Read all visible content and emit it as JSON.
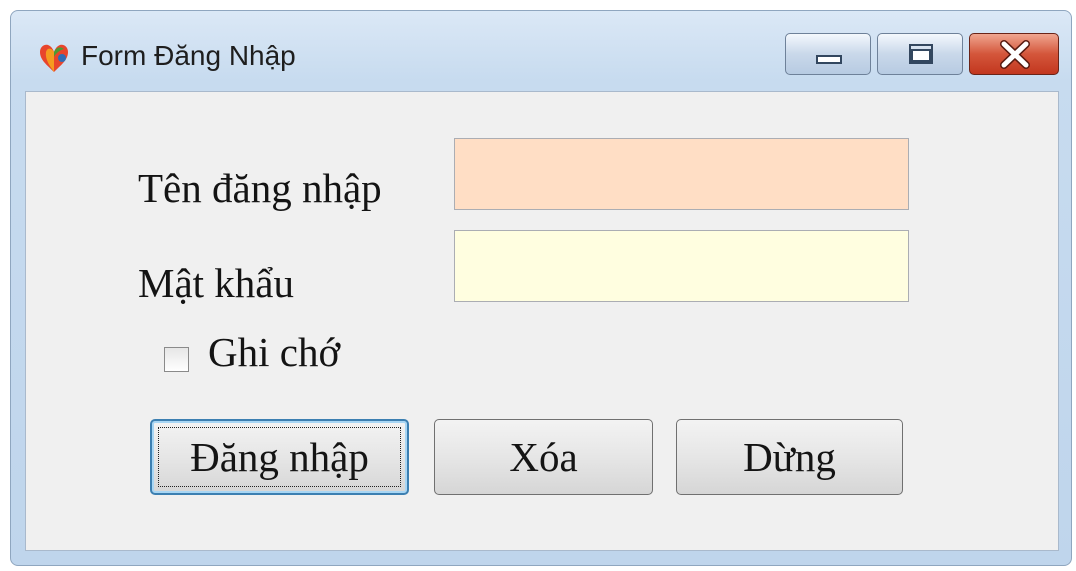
{
  "window": {
    "title": "Form Đăng Nhập"
  },
  "form": {
    "username_label": "Tên đăng nhập",
    "username_value": "",
    "password_label": "Mật khẩu",
    "password_value": "",
    "remember_label": "Ghi chớ",
    "remember_checked": false,
    "colors": {
      "username_field_bg": "#ffdec5",
      "password_field_bg": "#fffee0"
    }
  },
  "buttons": {
    "login": "Đăng nhập",
    "clear": "Xóa",
    "stop": "Dừng"
  },
  "icons": {
    "app": "app-logo-icon",
    "minimize": "minimize-icon",
    "maximize": "maximize-icon",
    "close": "close-icon"
  }
}
